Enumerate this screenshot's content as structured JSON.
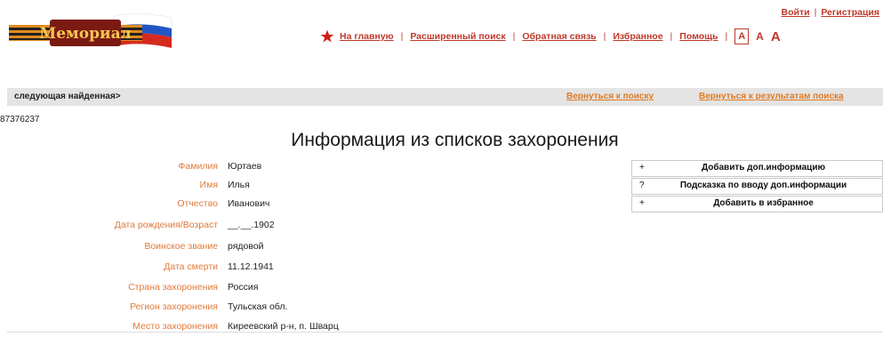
{
  "header": {
    "logo_text": "Мемориал",
    "auth": {
      "login": "Войти",
      "register": "Регистрация"
    },
    "nav": [
      "На главную",
      "Расширенный поиск",
      "Обратная связь",
      "Избранное",
      "Помощь"
    ],
    "font_sizes": [
      "А",
      "А",
      "А"
    ]
  },
  "bar": {
    "next": "следующая найденная>",
    "back_to_search": "Вернуться к поиску",
    "back_to_results": "Вернуться к результатам поиска"
  },
  "record_id": "87376237",
  "title": "Информация из списков захоронения",
  "fields": [
    {
      "label": "Фамилия",
      "value": "Юртаев"
    },
    {
      "label": "Имя",
      "value": "Илья"
    },
    {
      "label": "Отчество",
      "value": "Иванович"
    },
    {
      "label": "Дата рождения/Возраст",
      "value": "__.__.1902"
    },
    {
      "label": "Воинское звание",
      "value": "рядовой"
    },
    {
      "label": "Дата смерти",
      "value": "11.12.1941"
    },
    {
      "label": "Страна захоронения",
      "value": "Россия"
    },
    {
      "label": "Регион захоронения",
      "value": "Тульская обл."
    },
    {
      "label": "Место захоронения",
      "value": "Киреевский р-н, п. Шварц"
    }
  ],
  "actions": [
    {
      "icon": "+",
      "label": "Добавить доп.информацию"
    },
    {
      "icon": "?",
      "label": "Подсказка по вводу доп.информации"
    },
    {
      "icon": "+",
      "label": "Добавить в избранное"
    }
  ],
  "colors": {
    "link": "#c0392b",
    "label": "#e07a3a",
    "bar": "#e4e4e4",
    "accent_orange": "#e07a22"
  }
}
